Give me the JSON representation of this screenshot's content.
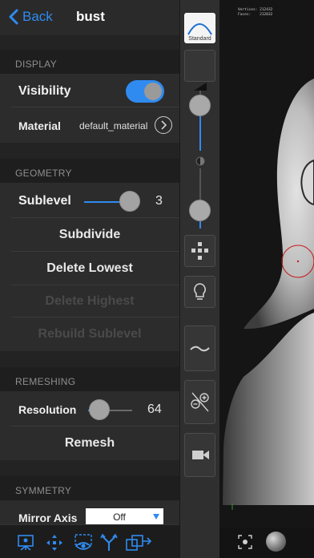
{
  "nav": {
    "back_label": "Back",
    "title": "bust"
  },
  "display": {
    "header": "DISPLAY",
    "visibility_label": "Visibility",
    "visibility_on": true,
    "material_label": "Material",
    "material_value": "default_material"
  },
  "geometry": {
    "header": "GEOMETRY",
    "sublevel_label": "Sublevel",
    "sublevel_value": "3",
    "sublevel_fraction": 0.95,
    "subdivide_label": "Subdivide",
    "delete_lowest_label": "Delete Lowest",
    "delete_highest_label": "Delete Highest",
    "rebuild_sublevel_label": "Rebuild Sublevel"
  },
  "remeshing": {
    "header": "REMESHING",
    "resolution_label": "Resolution",
    "resolution_value": "64",
    "resolution_fraction": 0.25,
    "remesh_label": "Remesh"
  },
  "symmetry": {
    "header": "SYMMETRY",
    "mirror_axis_label": "Mirror Axis",
    "mirror_axis_value": "Off"
  },
  "bottom_toolbar": {
    "icons": [
      "scene-icon",
      "transform-icon",
      "visibility-icon",
      "topology-icon",
      "export-icon"
    ]
  },
  "tool_strip": {
    "brush_label": "Standard",
    "radius_fraction": 0.75,
    "intensity_fraction": 0.3
  },
  "viewport": {
    "vertices_label": "Vertices:",
    "vertices_value": "212432",
    "faces_label": "Faces:",
    "faces_value": "212032"
  },
  "colors": {
    "accent": "#2f8bf0",
    "panel": "#232323",
    "row": "#2c2c2c",
    "remesh_circle": "#c81818"
  }
}
